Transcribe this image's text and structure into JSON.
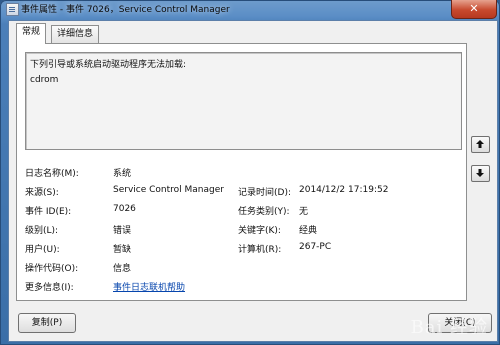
{
  "window": {
    "title": "事件属性 - 事件 7026，Service Control Manager",
    "close_glyph": "✕"
  },
  "tabs": [
    {
      "label": "常规",
      "active": true
    },
    {
      "label": "详细信息",
      "active": false
    }
  ],
  "message": {
    "line1": "下列引导或系统启动驱动程序无法加载:",
    "line2": "cdrom"
  },
  "properties": {
    "log_name_label": "日志名称(M):",
    "log_name_value": "系统",
    "source_label": "来源(S):",
    "source_value": "Service Control Manager",
    "logged_label": "记录时间(D):",
    "logged_value": "2014/12/2 17:19:52",
    "event_id_label": "事件 ID(E):",
    "event_id_value": "7026",
    "task_category_label": "任务类别(Y):",
    "task_category_value": "无",
    "level_label": "级别(L):",
    "level_value": "错误",
    "keywords_label": "关键字(K):",
    "keywords_value": "经典",
    "user_label": "用户(U):",
    "user_value": "暂缺",
    "computer_label": "计算机(R):",
    "computer_value": "267-PC",
    "opcode_label": "操作代码(O):",
    "opcode_value": "信息",
    "more_info_label": "更多信息(I):",
    "more_info_link": "事件日志联机帮助"
  },
  "buttons": {
    "copy": "复制(P)",
    "close": "关闭(C)"
  },
  "watermark": "Bai 经验",
  "icons": [
    "app-icon",
    "arrow-up-icon",
    "arrow-down-icon",
    "close-icon"
  ]
}
